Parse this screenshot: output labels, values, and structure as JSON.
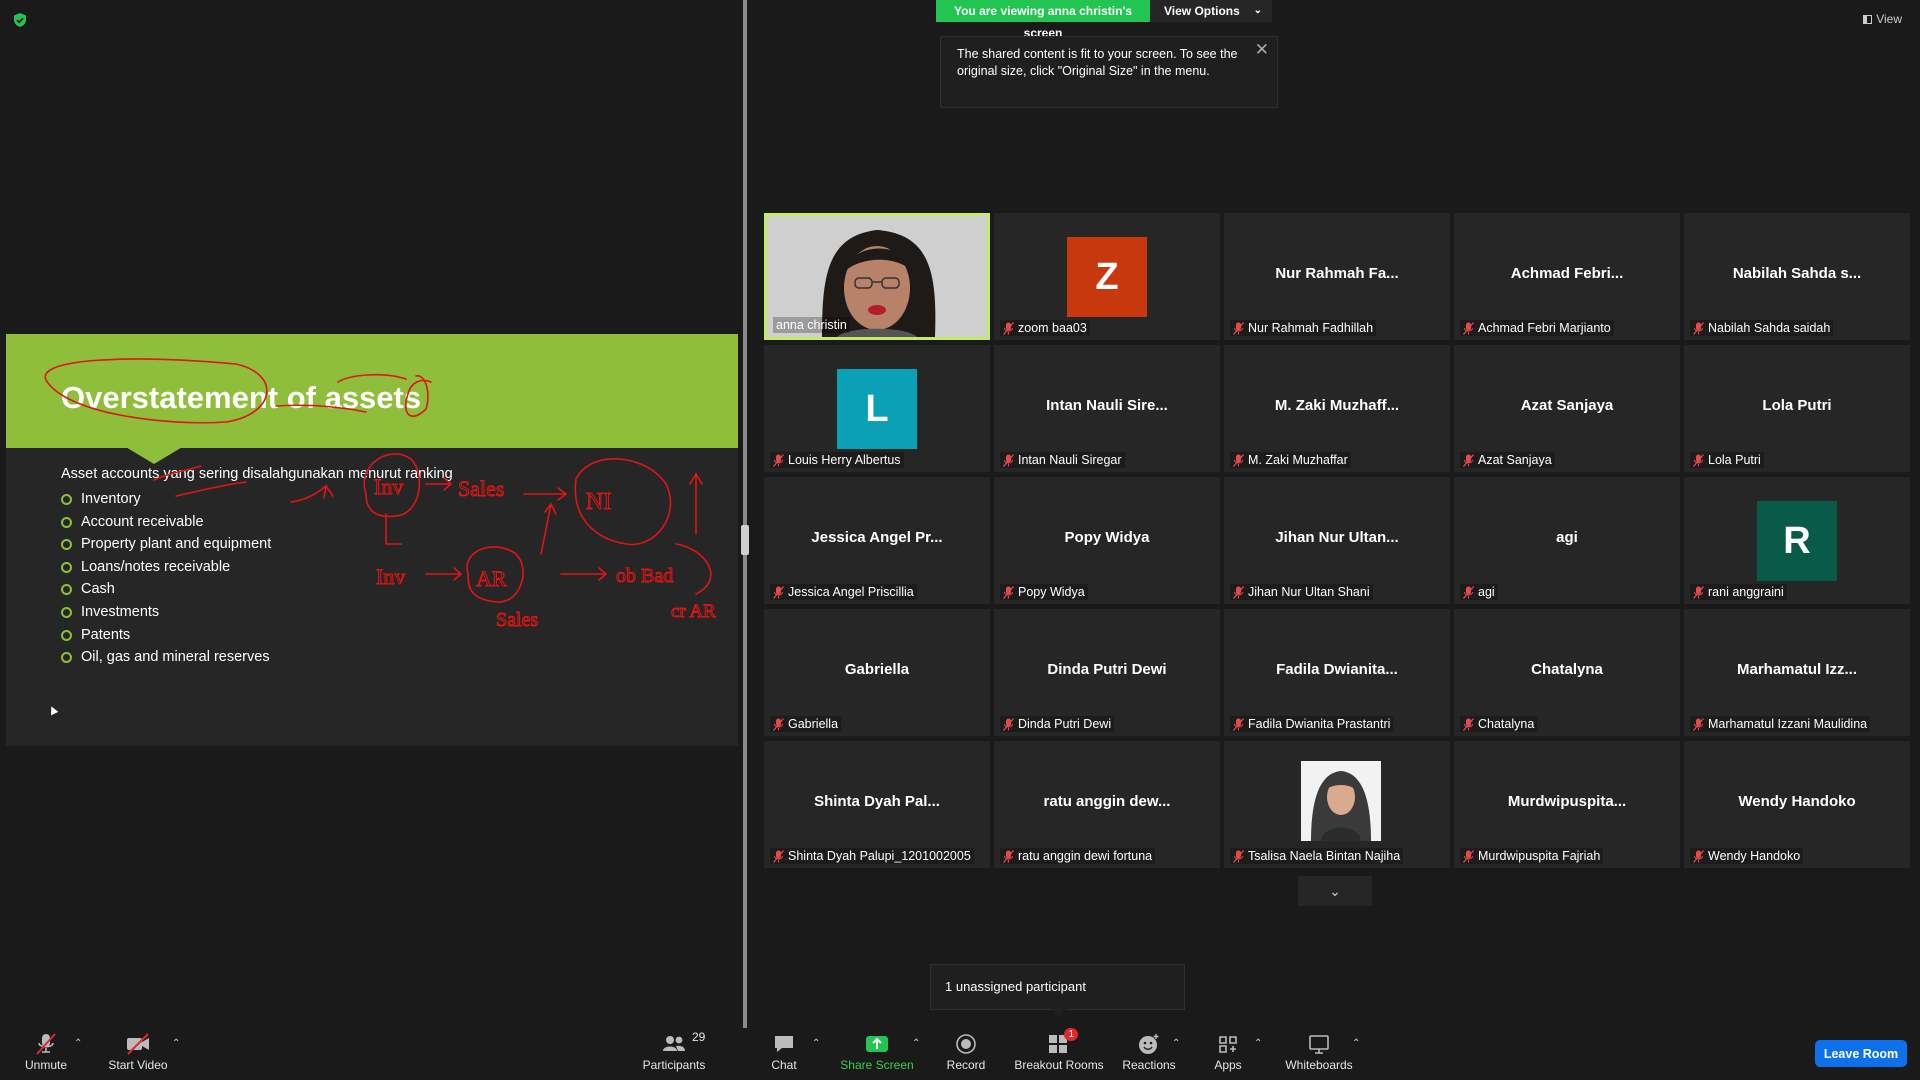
{
  "share_banner": {
    "viewing_label": "You are viewing anna christin's screen",
    "view_options_label": "View Options"
  },
  "tooltip": {
    "text": "The shared content is fit to your screen. To see the original size, click \"Original Size\" in the menu."
  },
  "view_top_label": "View",
  "slide": {
    "title": "Overstatement of assets",
    "intro": "Asset accounts yang sering disalahgunakan menurut ranking",
    "bullets": [
      "Inventory",
      "Account receivable",
      "Property plant and equipment",
      "Loans/notes receivable",
      "Cash",
      "Investments",
      "Patents",
      "Oil, gas and mineral reserves"
    ],
    "header_color": "#8fbe3a"
  },
  "participants": [
    {
      "center": "",
      "name": "anna christin",
      "type": "video",
      "muted": false
    },
    {
      "center": "Z",
      "name": "zoom baa03",
      "type": "avatar",
      "avatar_color": "#c7380e",
      "muted": true
    },
    {
      "center": "Nur Rahmah Fa...",
      "name": "Nur Rahmah Fadhillah",
      "type": "text",
      "muted": true
    },
    {
      "center": "Achmad Febri...",
      "name": "Achmad Febri Marjianto",
      "type": "text",
      "muted": true
    },
    {
      "center": "Nabilah Sahda s...",
      "name": "Nabilah Sahda saidah",
      "type": "text",
      "muted": true
    },
    {
      "center": "L",
      "name": "Louis Herry Albertus",
      "type": "avatar",
      "avatar_color": "#0aa0b5",
      "muted": true
    },
    {
      "center": "Intan Nauli Sire...",
      "name": "Intan Nauli Siregar",
      "type": "text",
      "muted": true
    },
    {
      "center": "M. Zaki Muzhaff...",
      "name": "M. Zaki Muzhaffar",
      "type": "text",
      "muted": true
    },
    {
      "center": "Azat Sanjaya",
      "name": "Azat Sanjaya",
      "type": "text",
      "muted": true
    },
    {
      "center": "Lola Putri",
      "name": "Lola Putri",
      "type": "text",
      "muted": true
    },
    {
      "center": "Jessica Angel Pr...",
      "name": "Jessica Angel Priscillia",
      "type": "text",
      "muted": true
    },
    {
      "center": "Popy Widya",
      "name": "Popy Widya",
      "type": "text",
      "muted": true
    },
    {
      "center": "Jihan Nur Ultan...",
      "name": "Jihan Nur Ultan Shani",
      "type": "text",
      "muted": true
    },
    {
      "center": "agi",
      "name": "agi",
      "type": "text",
      "muted": true
    },
    {
      "center": "R",
      "name": "rani anggraini",
      "type": "avatar",
      "avatar_color": "#0a5a4a",
      "muted": true
    },
    {
      "center": "Gabriella",
      "name": "Gabriella",
      "type": "text",
      "muted": true
    },
    {
      "center": "Dinda Putri Dewi",
      "name": "Dinda Putri Dewi",
      "type": "text",
      "muted": true
    },
    {
      "center": "Fadila Dwianita...",
      "name": "Fadila Dwianita Prastantri",
      "type": "text",
      "muted": true
    },
    {
      "center": "Chatalyna",
      "name": "Chatalyna",
      "type": "text",
      "muted": true
    },
    {
      "center": "Marhamatul Izz...",
      "name": "Marhamatul Izzani Maulidina",
      "type": "text",
      "muted": true
    },
    {
      "center": "Shinta Dyah Pal...",
      "name": "Shinta Dyah Palupi_1201002005",
      "type": "text",
      "muted": true
    },
    {
      "center": "ratu anggin dew...",
      "name": "ratu anggin dewi fortuna",
      "type": "text",
      "muted": true
    },
    {
      "center": "",
      "name": "Tsalisa Naela Bintan Najiha",
      "type": "photo",
      "muted": true
    },
    {
      "center": "Murdwipuspita...",
      "name": "Murdwipuspita Fajriah",
      "type": "text",
      "muted": true
    },
    {
      "center": "Wendy Handoko",
      "name": "Wendy Handoko",
      "type": "text",
      "muted": true
    }
  ],
  "unassigned_tip": "1 unassigned participant",
  "toolbar": {
    "unmute": "Unmute",
    "start_video": "Start Video",
    "participants": "Participants",
    "participants_count": "29",
    "chat": "Chat",
    "share_screen": "Share Screen",
    "record": "Record",
    "breakout_rooms": "Breakout Rooms",
    "breakout_badge": "1",
    "reactions": "Reactions",
    "apps": "Apps",
    "whiteboards": "Whiteboards",
    "leave_room": "Leave Room"
  }
}
